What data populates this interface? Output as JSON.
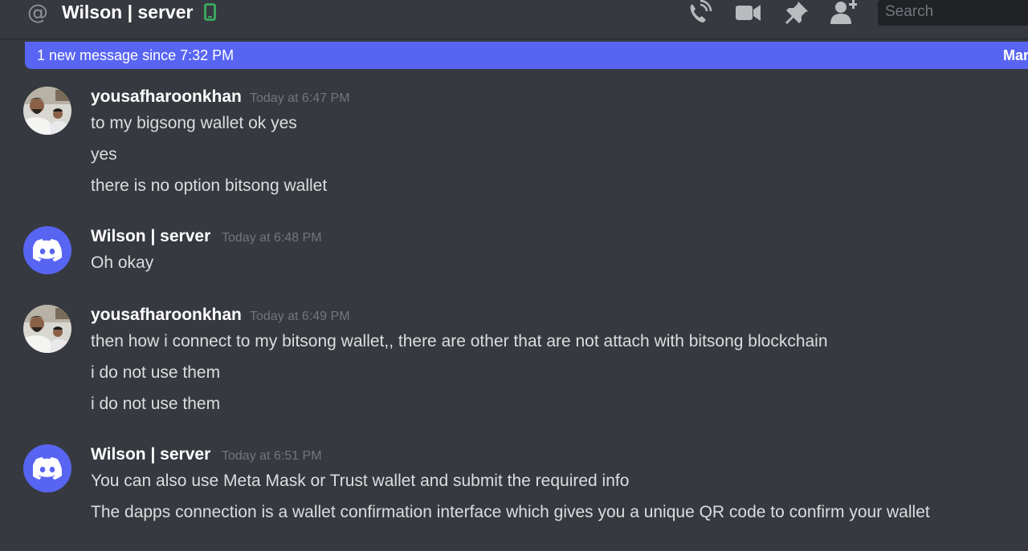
{
  "header": {
    "at_symbol": "@",
    "channel_name": "Wilson | server",
    "status_icon": "mobile-online-icon",
    "status_color": "#3ba55d",
    "toolbar_icons": [
      "call-icon",
      "video-icon",
      "pin-icon",
      "add-user-icon"
    ],
    "search_placeholder": "Search"
  },
  "banner": {
    "text": "1 new message since 7:32 PM",
    "action": "Mar",
    "color": "#5865f2"
  },
  "messages": [
    {
      "author": "yousafharoonkhan",
      "timestamp": "Today at 6:47 PM",
      "avatar": "photo-avatar",
      "lines": [
        "to my bigsong wallet ok yes",
        "yes",
        "there is no option bitsong wallet"
      ]
    },
    {
      "author": "Wilson | server",
      "timestamp": "Today at 6:48 PM",
      "avatar": "discord-logo-avatar",
      "lines": [
        "Oh okay"
      ]
    },
    {
      "author": "yousafharoonkhan",
      "timestamp": "Today at 6:49 PM",
      "avatar": "photo-avatar",
      "lines": [
        "then how i connect to my bitsong wallet,, there are other that are not attach with bitsong blockchain",
        "i do not use them",
        "i do not use them"
      ]
    },
    {
      "author": "Wilson | server",
      "timestamp": "Today at 6:51 PM",
      "avatar": "discord-logo-avatar",
      "lines": [
        "You can also use Meta Mask or Trust wallet and submit the required info",
        "The dapps connection is a wallet confirmation interface which gives you a unique QR code to confirm your wallet"
      ]
    }
  ]
}
